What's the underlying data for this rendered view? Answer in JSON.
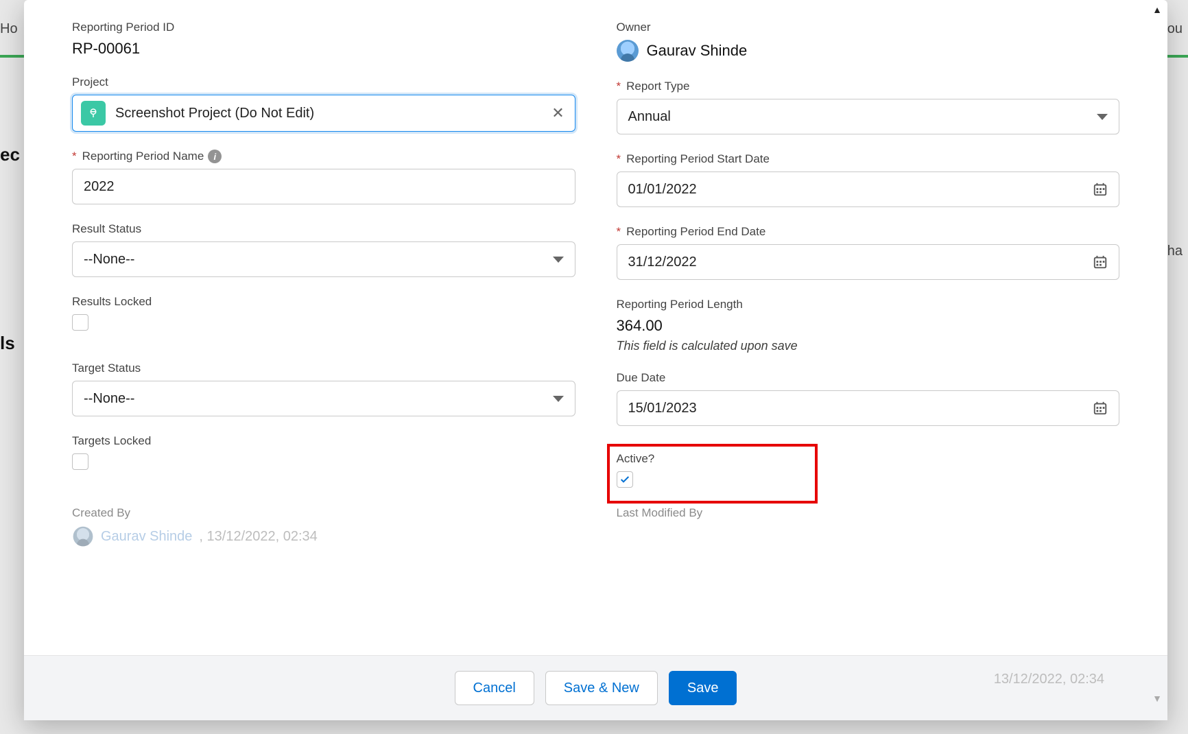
{
  "background": {
    "left1": "Ho",
    "left2": "ec",
    "left3": "ls",
    "right1": "ou",
    "right2": "ha"
  },
  "form": {
    "left": {
      "id_label": "Reporting Period ID",
      "id_value": "RP-00061",
      "project_label": "Project",
      "project_value": "Screenshot Project (Do Not Edit)",
      "name_label": "Reporting Period Name",
      "name_value": "2022",
      "result_status_label": "Result Status",
      "result_status_value": "--None--",
      "results_locked_label": "Results Locked",
      "target_status_label": "Target Status",
      "target_status_value": "--None--",
      "targets_locked_label": "Targets Locked",
      "created_by_label": "Created By",
      "created_by_name": "Gaurav Shinde",
      "created_by_ts": ", 13/12/2022, 02:34"
    },
    "right": {
      "owner_label": "Owner",
      "owner_name": "Gaurav Shinde",
      "report_type_label": "Report Type",
      "report_type_value": "Annual",
      "start_label": "Reporting Period Start Date",
      "start_value": "01/01/2022",
      "end_label": "Reporting Period End Date",
      "end_value": "31/12/2022",
      "length_label": "Reporting Period Length",
      "length_value": "364.00",
      "length_helper": "This field is calculated upon save",
      "due_label": "Due Date",
      "due_value": "15/01/2023",
      "active_label": "Active?",
      "modified_by_label": "Last Modified By",
      "modified_by_ts": "13/12/2022, 02:34"
    }
  },
  "footer": {
    "cancel": "Cancel",
    "save_new": "Save & New",
    "save": "Save"
  }
}
